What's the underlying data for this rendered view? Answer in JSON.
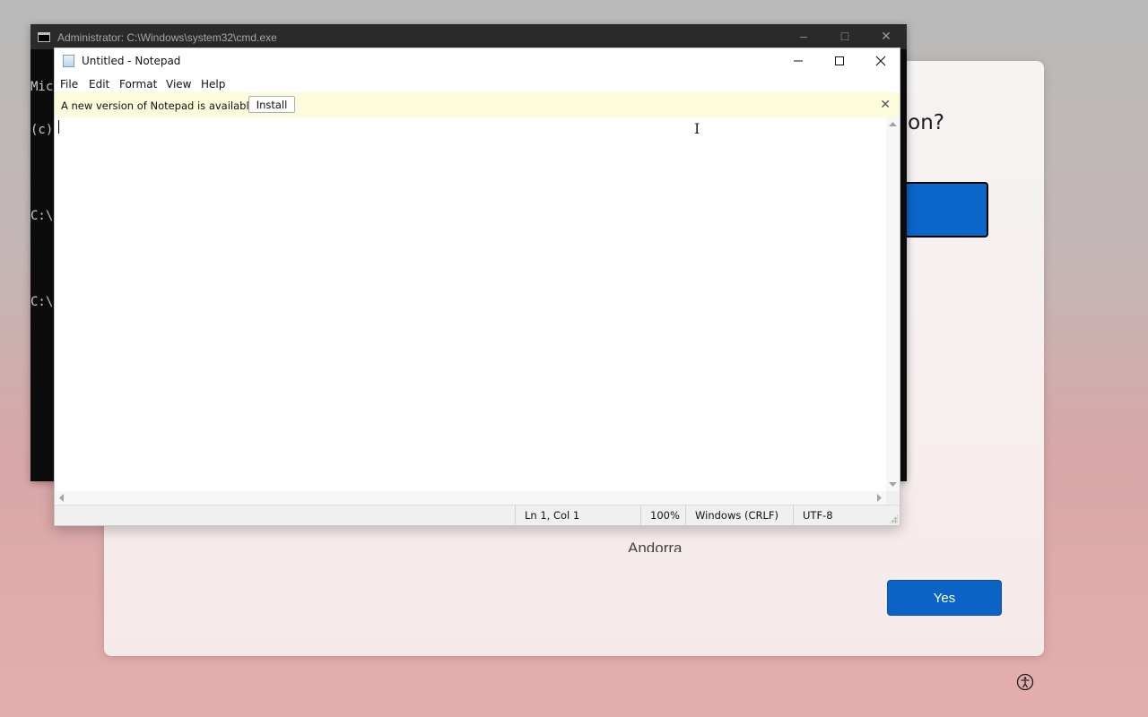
{
  "oobe": {
    "heading_fragment": "on?",
    "partial_text": "Andorra",
    "yes_button": "Yes",
    "accessibility_icon": "accessibility-icon"
  },
  "cmd": {
    "title": "Administrator: C:\\Windows\\system32\\cmd.exe",
    "lines": [
      "Mic",
      "(c)",
      "",
      "C:\\",
      "",
      "C:\\"
    ]
  },
  "notepad": {
    "title": "Untitled - Notepad",
    "menu": [
      "File",
      "Edit",
      "Format",
      "View",
      "Help"
    ],
    "infobar": {
      "message": "A new version of Notepad is available.",
      "install_label": "Install",
      "close_icon": "close-icon"
    },
    "content": "",
    "status": {
      "position": "Ln 1, Col 1",
      "zoom": "100%",
      "line_endings": "Windows (CRLF)",
      "encoding": "UTF-8"
    }
  },
  "colors": {
    "accent": "#0a63c5",
    "infobar_bg": "#fcfcdd",
    "cmd_bg": "#0c0c0c"
  }
}
